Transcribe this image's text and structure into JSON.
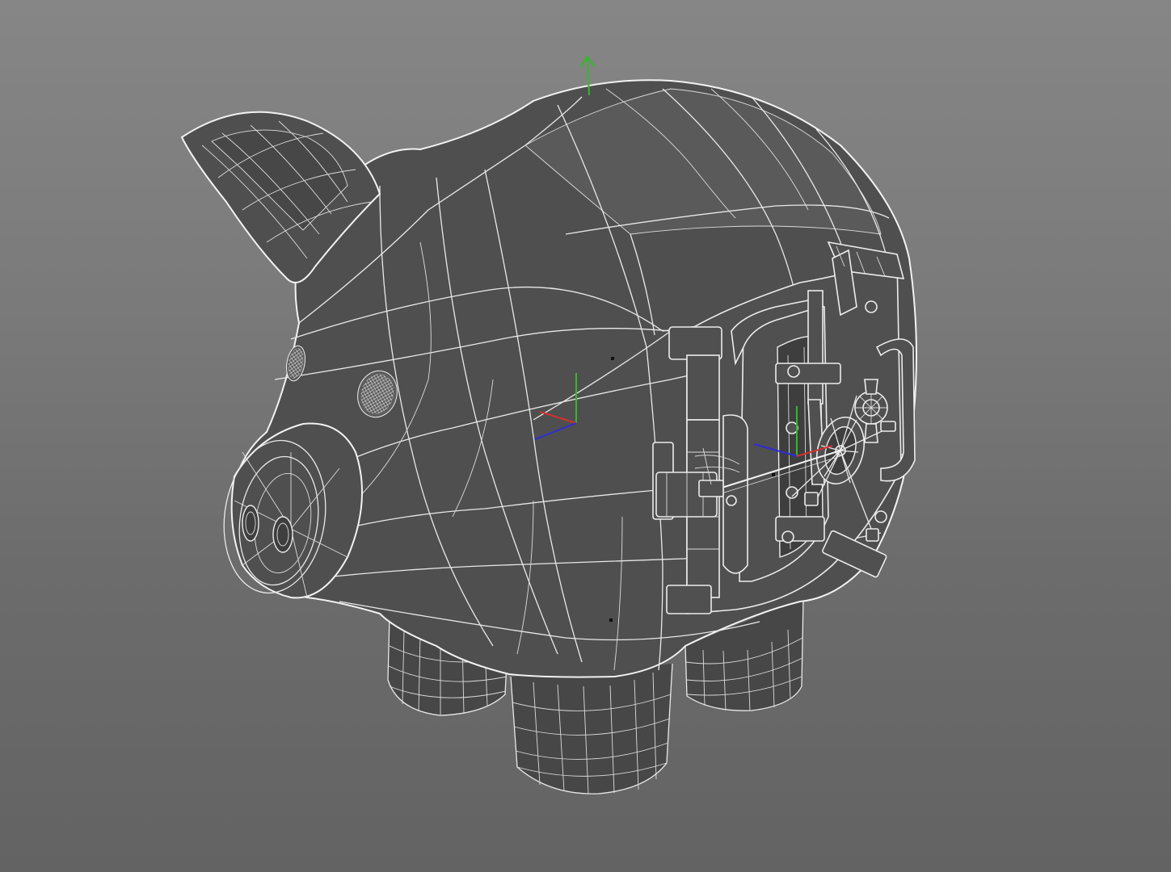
{
  "viewport": {
    "background_top": "#868686",
    "background_bottom": "#636363",
    "model": {
      "shade_color": "#4f4f4f",
      "wire_color": "#e9e9e9"
    },
    "gizmo_colors": {
      "x_axis": "#d0312d",
      "y_axis": "#35b82a",
      "z_axis": "#2d2dd6"
    },
    "icons": [
      "move-gizmo-icon",
      "up-arrow-icon",
      "pivot-icon"
    ]
  }
}
